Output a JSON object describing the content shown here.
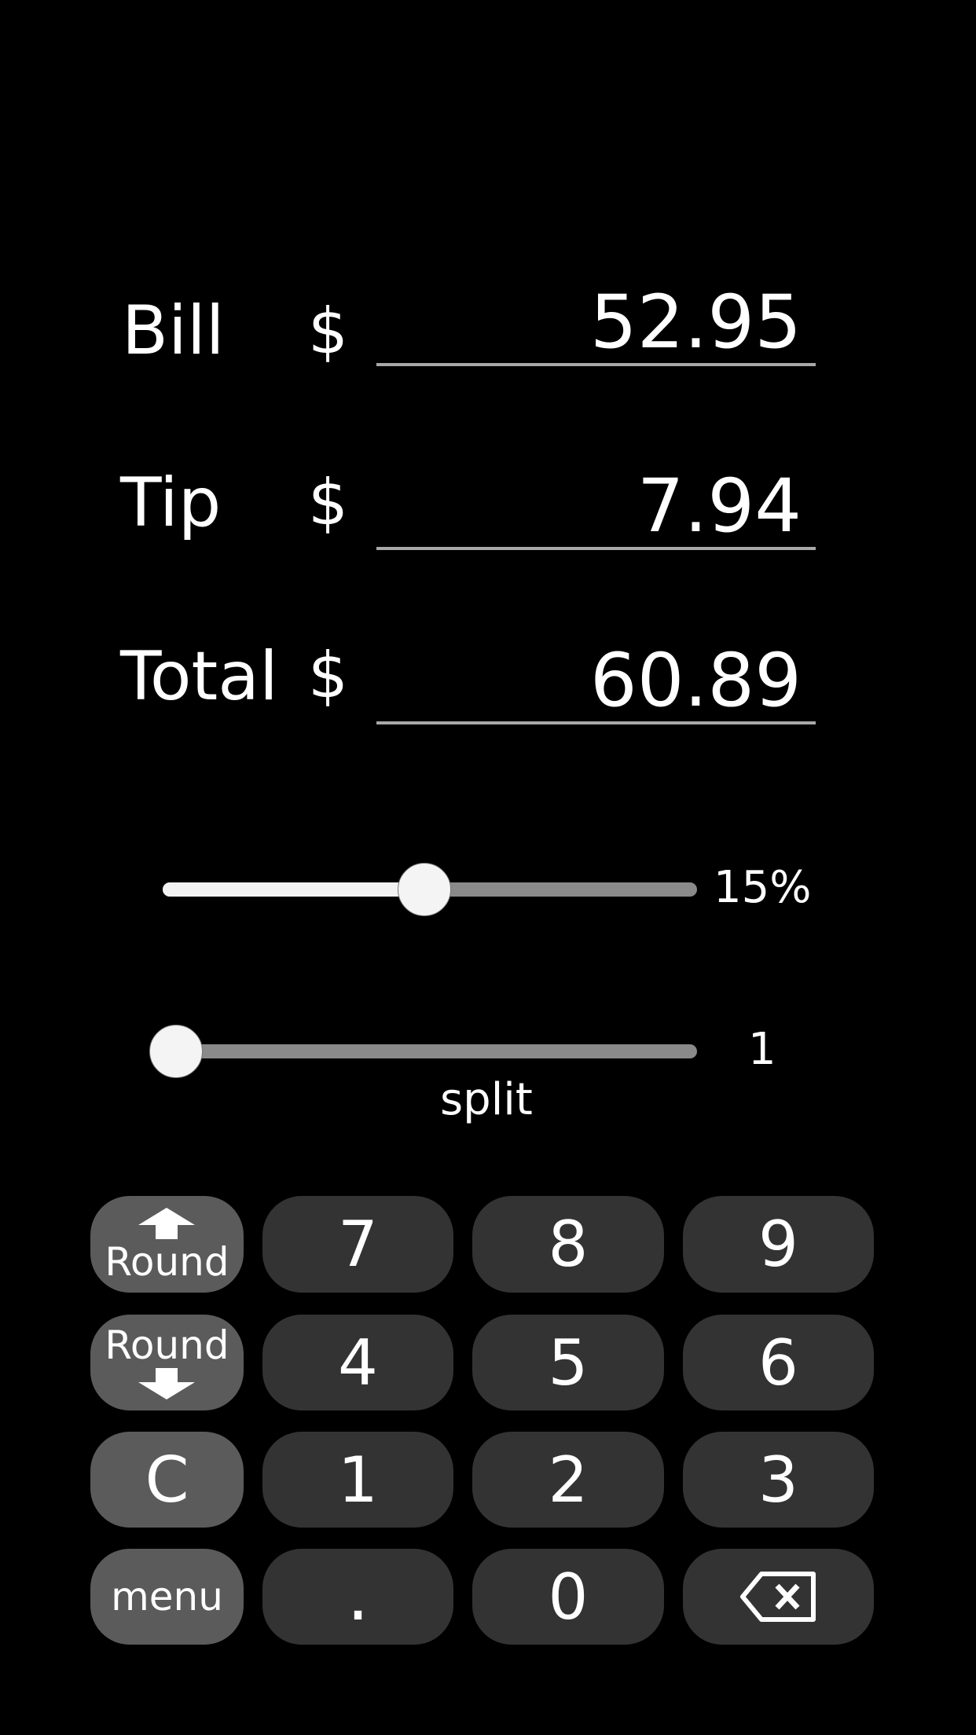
{
  "fields": [
    {
      "label": "Bill",
      "currency": "$",
      "value": "52.95"
    },
    {
      "label": "Tip",
      "currency": "$",
      "value": "7.94"
    },
    {
      "label": "Total",
      "currency": "$",
      "value": "60.89"
    }
  ],
  "tip_slider": {
    "value_label": "15%",
    "fraction": 0.49
  },
  "split_slider": {
    "value_label": "1",
    "caption": "split",
    "fraction": 0.0
  },
  "keypad": {
    "round_up": "Round",
    "round_down": "Round",
    "clear": "C",
    "menu": "menu",
    "digits": [
      "7",
      "8",
      "9",
      "4",
      "5",
      "6",
      "1",
      "2",
      "3"
    ],
    "dot": ".",
    "zero": "0",
    "backspace_icon": "backspace-icon"
  },
  "colors": {
    "background": "#000000",
    "key": "#333333",
    "side_key": "#5b5b5b",
    "track": "#8a8a8a",
    "fill": "#f2f2f2"
  }
}
